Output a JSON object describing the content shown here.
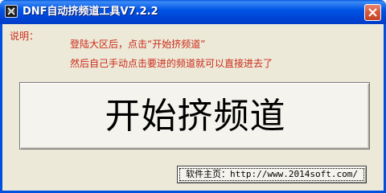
{
  "window": {
    "title": "DNF自动挤频道工具V7.2.2",
    "icon": "app-icon",
    "close_icon": "close-icon"
  },
  "notes": {
    "label": "说明：",
    "line1": "登陆大区后，点击“开始挤频道”",
    "line2": "然后自己手动点击要进的频道就可以直接进去了"
  },
  "main_button": {
    "label": "开始挤频道"
  },
  "homepage_button": {
    "label": "软件主页：http://www.2014soft.com/"
  },
  "colors": {
    "titlebar": "#0055e5",
    "note_text": "#cc2a1a",
    "client_bg": "#ece9d8",
    "close_button": "#d85a3d"
  }
}
